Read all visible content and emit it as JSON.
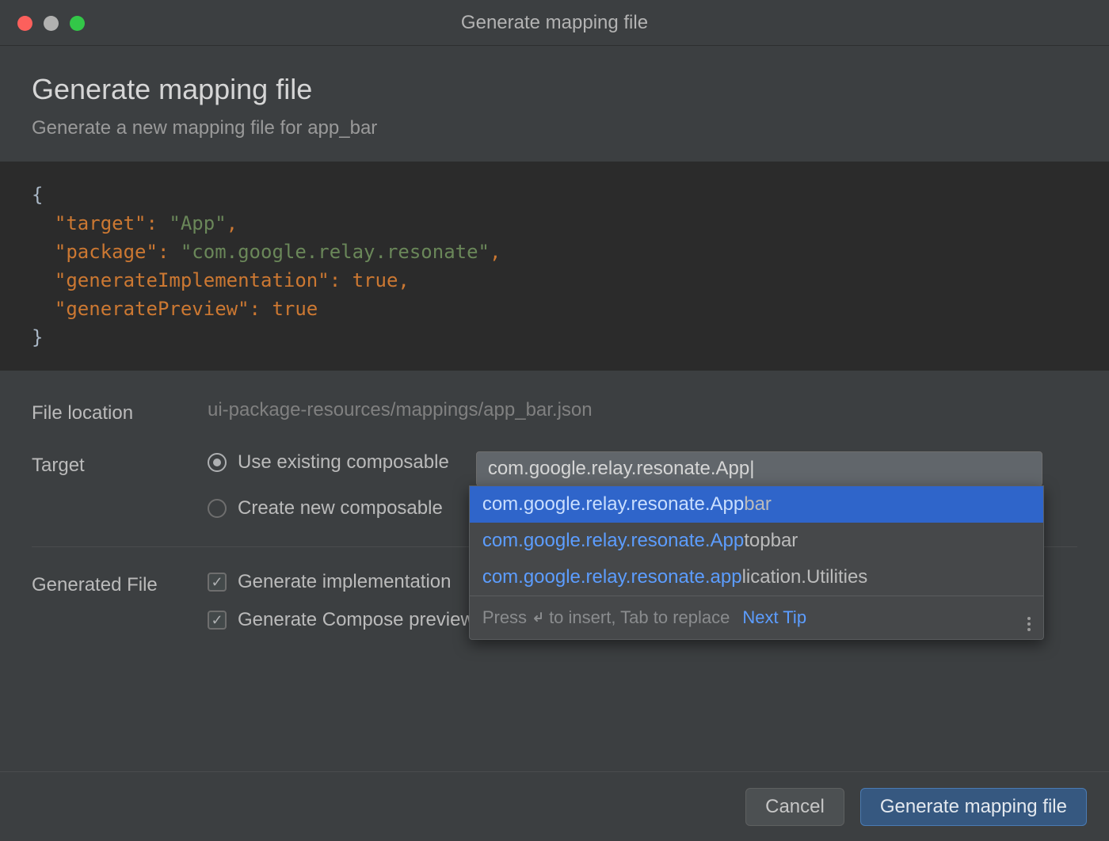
{
  "titlebar": {
    "title": "Generate mapping file"
  },
  "header": {
    "title": "Generate mapping file",
    "subtitle": "Generate a new mapping file for app_bar"
  },
  "code": {
    "k_target": "\"target\"",
    "v_target": "\"App\"",
    "k_package": "\"package\"",
    "v_package": "\"com.google.relay.resonate\"",
    "k_genImpl": "\"generateImplementation\"",
    "v_genImpl": "true",
    "k_genPrev": "\"generatePreview\"",
    "v_genPrev": "true"
  },
  "fileLocation": {
    "label": "File location",
    "value": "ui-package-resources/mappings/app_bar.json"
  },
  "target": {
    "label": "Target",
    "radio_existing": "Use existing composable",
    "radio_new": "Create new composable",
    "input_value": "com.google.relay.resonate.App|"
  },
  "autocomplete": {
    "items": [
      {
        "match": "com.google.relay.resonate.App",
        "rest": "bar"
      },
      {
        "match": "com.google.relay.resonate.App",
        "rest": "topbar"
      },
      {
        "match": "com.google.relay.resonate.app",
        "rest": "lication.Utilities"
      }
    ],
    "hint_pre": "Press ",
    "hint_post": " to insert, Tab to replace",
    "tip": "Next Tip"
  },
  "generated": {
    "label": "Generated File",
    "check_impl": "Generate implementation",
    "check_preview": "Generate Compose preview"
  },
  "footer": {
    "cancel": "Cancel",
    "generate": "Generate mapping file"
  }
}
